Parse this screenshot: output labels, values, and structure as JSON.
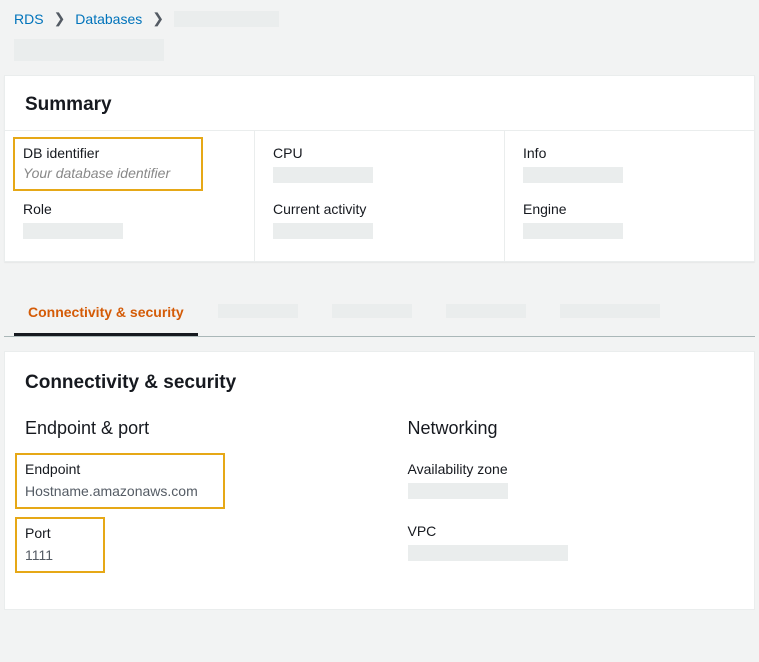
{
  "breadcrumb": {
    "root": "RDS",
    "second": "Databases"
  },
  "summary": {
    "heading": "Summary",
    "col1": {
      "db_identifier_label": "DB identifier",
      "db_identifier_value_prefix": "Your database identifier",
      "role_label": "Role"
    },
    "col2": {
      "cpu_label": "CPU",
      "activity_label": "Current activity"
    },
    "col3": {
      "info_label": "Info",
      "engine_label": "Engine"
    }
  },
  "tabs": {
    "active": "Connectivity & security"
  },
  "connectivity": {
    "heading": "Connectivity & security",
    "endpoint_port_heading": "Endpoint & port",
    "endpoint_label": "Endpoint",
    "endpoint_value_prefix": "Hostname",
    "endpoint_value_suffix": ".amazonaws.com",
    "port_label": "Port",
    "port_value": "1111",
    "networking_heading": "Networking",
    "az_label": "Availability zone",
    "vpc_label": "VPC"
  }
}
